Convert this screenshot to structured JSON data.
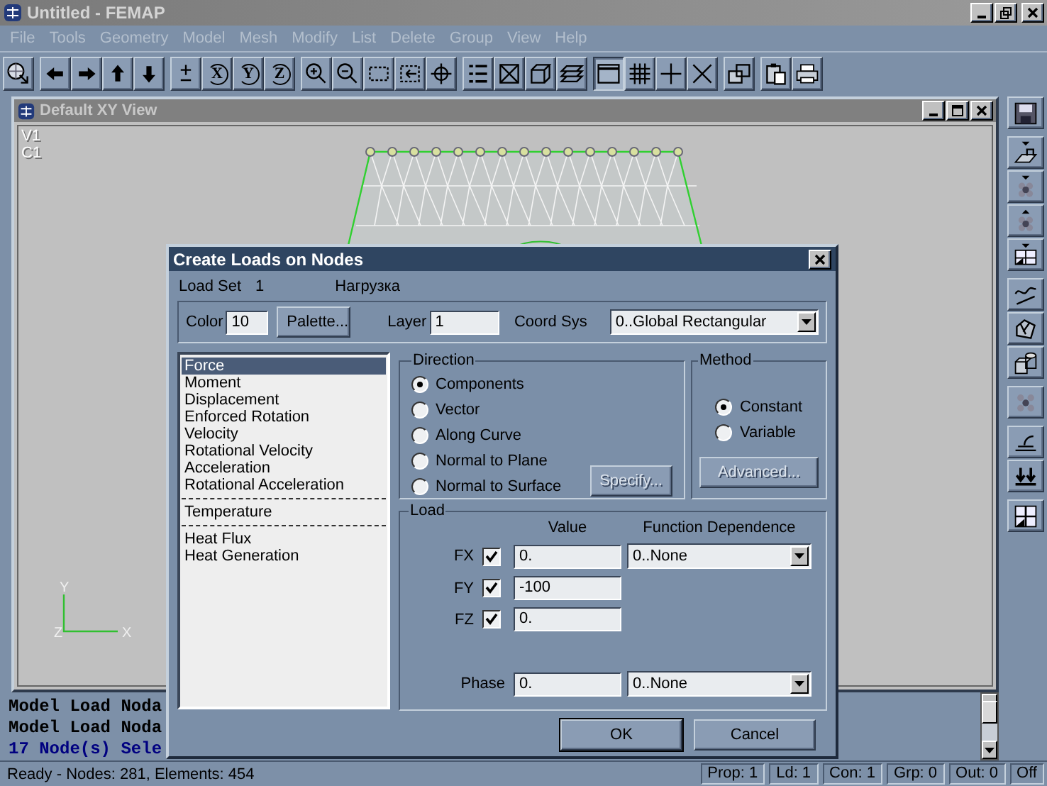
{
  "window": {
    "title": "Untitled - FEMAP"
  },
  "menu": [
    "File",
    "Tools",
    "Geometry",
    "Model",
    "Mesh",
    "Modify",
    "List",
    "Delete",
    "Group",
    "View",
    "Help"
  ],
  "toolbar": [
    [
      {
        "kind": "view-select",
        "pressed": false
      }
    ],
    [
      {
        "kind": "arrow-left",
        "pressed": false
      },
      {
        "kind": "arrow-right",
        "pressed": false
      },
      {
        "kind": "arrow-up",
        "pressed": false
      },
      {
        "kind": "arrow-down",
        "pressed": false
      }
    ],
    [
      {
        "kind": "plus-minus",
        "pressed": false
      },
      {
        "kind": "rotate",
        "label": "X",
        "pressed": false
      },
      {
        "kind": "rotate",
        "label": "Y",
        "pressed": false
      },
      {
        "kind": "rotate",
        "label": "Z",
        "pressed": false
      }
    ],
    [
      {
        "kind": "zoom-in",
        "pressed": false
      },
      {
        "kind": "zoom-out",
        "pressed": false
      },
      {
        "kind": "dashed-rect",
        "pressed": false
      },
      {
        "kind": "dashed-rect-arrow",
        "pressed": false
      },
      {
        "kind": "crosshair",
        "pressed": false
      }
    ],
    [
      {
        "kind": "list",
        "pressed": false
      },
      {
        "kind": "box-x",
        "pressed": false
      },
      {
        "kind": "cube",
        "pressed": false
      },
      {
        "kind": "layers",
        "pressed": false
      }
    ],
    [
      {
        "kind": "window",
        "pressed": true
      },
      {
        "kind": "grid",
        "pressed": false
      },
      {
        "kind": "plus",
        "pressed": false
      },
      {
        "kind": "cross",
        "pressed": false
      }
    ],
    [
      {
        "kind": "copy",
        "pressed": false
      }
    ],
    [
      {
        "kind": "clipboard",
        "pressed": false
      },
      {
        "kind": "printer",
        "pressed": false
      }
    ]
  ],
  "side_toolbar": [
    [
      {
        "kind": "disk"
      }
    ],
    [
      {
        "kind": "surface-load"
      },
      {
        "kind": "nodes-down"
      },
      {
        "kind": "nodes-up"
      },
      {
        "kind": "panel-down"
      }
    ],
    [
      {
        "kind": "curve"
      },
      {
        "kind": "bricks"
      },
      {
        "kind": "solids"
      }
    ],
    [
      {
        "kind": "nodes"
      }
    ],
    [
      {
        "kind": "trowel"
      },
      {
        "kind": "double-arrow"
      }
    ],
    [
      {
        "kind": "quad"
      }
    ]
  ],
  "view": {
    "title": "Default XY View",
    "labels": [
      "V1",
      "C1"
    ],
    "axes": {
      "y": "Y",
      "z": "Z",
      "x": "X"
    }
  },
  "messages": [
    {
      "text": "Model Load Noda",
      "color": "#000000"
    },
    {
      "text": "Model Load Noda",
      "color": "#000000"
    },
    {
      "text": "17 Node(s) Sele",
      "color": "#000080"
    }
  ],
  "status_bar": {
    "message": "Ready - Nodes: 281,  Elements: 454",
    "panes": [
      "Prop: 1",
      "Ld: 1",
      "Con: 1",
      "Grp: 0",
      "Out: 0",
      "Off"
    ]
  },
  "dialog": {
    "title": "Create Loads on Nodes",
    "load_set": {
      "label": "Load Set",
      "number": "1",
      "name": "Нагрузка"
    },
    "color": {
      "label": "Color",
      "value": "10"
    },
    "palette_button": {
      "label": "Palette..."
    },
    "layer": {
      "label": "Layer",
      "value": "1"
    },
    "coord_sys": {
      "label": "Coord Sys",
      "value": "0..Global Rectangular"
    },
    "load_types": [
      [
        {
          "label": "Force",
          "selected": true
        },
        {
          "label": "Moment",
          "selected": false
        },
        {
          "label": "Displacement",
          "selected": false
        },
        {
          "label": "Enforced Rotation",
          "selected": false
        },
        {
          "label": "Velocity",
          "selected": false
        },
        {
          "label": "Rotational Velocity",
          "selected": false
        },
        {
          "label": "Acceleration",
          "selected": false
        },
        {
          "label": "Rotational Acceleration",
          "selected": false
        }
      ],
      [
        {
          "label": "Temperature",
          "selected": false
        }
      ],
      [
        {
          "label": "Heat Flux",
          "selected": false
        },
        {
          "label": "Heat Generation",
          "selected": false
        }
      ]
    ],
    "direction": {
      "label": "Direction",
      "options": [
        {
          "label": "Components",
          "selected": true
        },
        {
          "label": "Vector",
          "selected": false
        },
        {
          "label": "Along Curve",
          "selected": false
        },
        {
          "label": "Normal to Plane",
          "selected": false
        },
        {
          "label": "Normal to Surface",
          "selected": false
        }
      ],
      "specify_button": {
        "label": "Specify...",
        "disabled": true
      }
    },
    "method": {
      "label": "Method",
      "options": [
        {
          "label": "Constant",
          "selected": true
        },
        {
          "label": "Variable",
          "selected": false
        }
      ],
      "advanced_button": {
        "label": "Advanced...",
        "disabled": true
      }
    },
    "load": {
      "label": "Load",
      "value_header": "Value",
      "function_header": "Function Dependence",
      "components": [
        {
          "label": "FX",
          "checked": true,
          "value": "0.",
          "function": "0..None"
        },
        {
          "label": "FY",
          "checked": true,
          "value": "-100"
        },
        {
          "label": "FZ",
          "checked": true,
          "value": "0."
        }
      ],
      "phase": {
        "label": "Phase",
        "value": "0.",
        "function": "0..None"
      }
    },
    "buttons": [
      {
        "label": "OK",
        "default": true
      },
      {
        "label": "Cancel",
        "default": false
      }
    ]
  }
}
